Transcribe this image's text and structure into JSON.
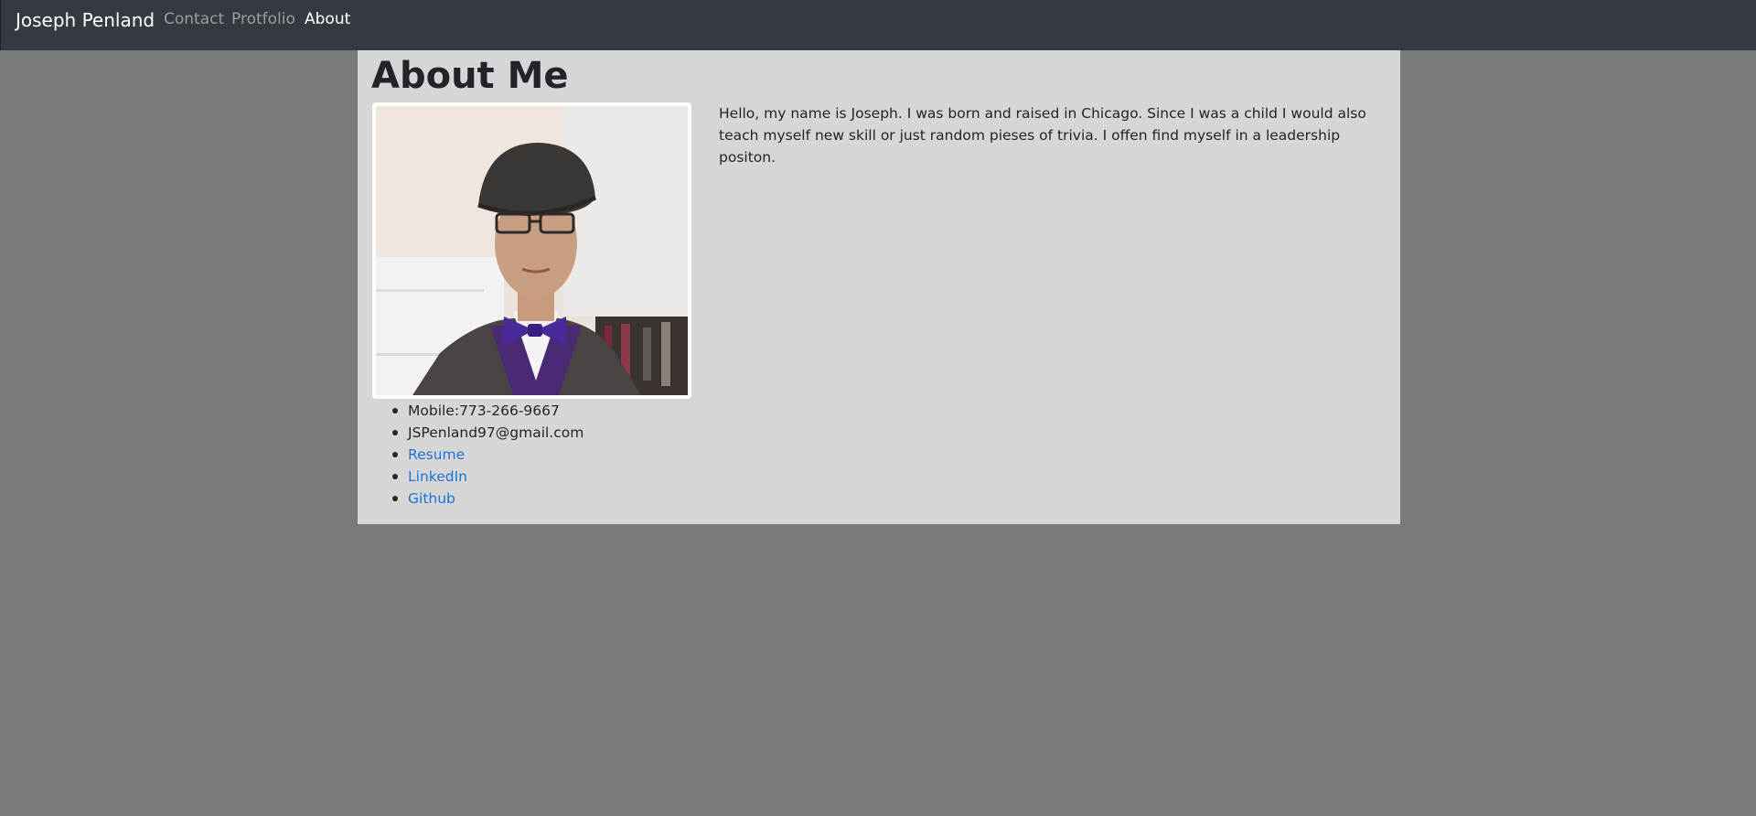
{
  "navbar": {
    "brand": "Joseph Penland",
    "links": [
      {
        "label": "Contact",
        "active": false
      },
      {
        "label": "Protfolio",
        "active": false
      },
      {
        "label": "About",
        "active": true
      }
    ]
  },
  "main": {
    "title": "About Me",
    "bio": "Hello, my name is Joseph. I was born and raised in Chicago. Since I was a child I would also teach myself new skill or just random pieses of trivia. I offen find myself in a leadership positon.",
    "contact": {
      "mobile": "Mobile:773-266-9667",
      "email": "JSPenland97@gmail.com",
      "links": [
        "Resume",
        "LinkedIn",
        "Github"
      ]
    }
  },
  "colors": {
    "navbar_bg": "#343a40",
    "page_bg": "#7a7a7a",
    "panel_bg": "#d6d6d6",
    "link": "#1a73d9"
  }
}
